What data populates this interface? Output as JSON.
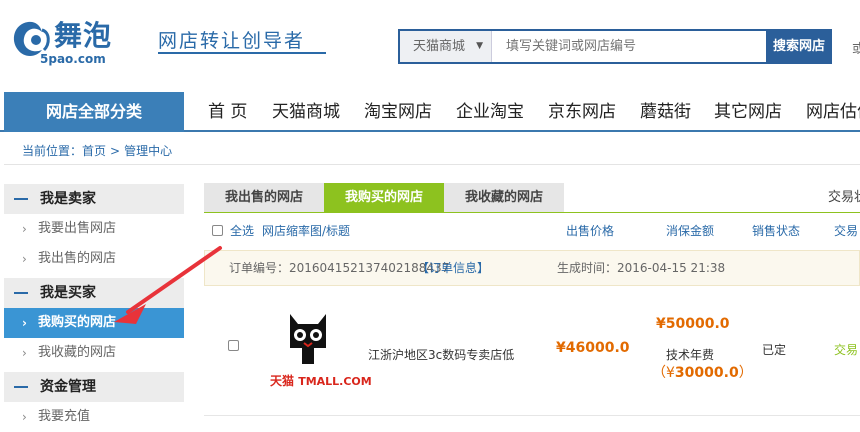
{
  "header": {
    "logo_text": "舞泡",
    "logo_url": "5pao.com",
    "slogan": "网店转让创导者",
    "search_category": "天猫商城",
    "search_placeholder": "填写关键词或网店编号",
    "search_button": "搜索网店",
    "extra": "或"
  },
  "nav": {
    "category_label": "网店全部分类",
    "items": [
      "首 页",
      "天猫商城",
      "淘宝网店",
      "企业淘宝",
      "京东网店",
      "蘑菇街",
      "其它网店",
      "网店估价"
    ]
  },
  "breadcrumb": {
    "prefix": "当前位置：",
    "items": [
      "首页",
      "管理中心"
    ],
    "separator": ">"
  },
  "sidebar": {
    "sections": [
      {
        "title": "我是卖家",
        "items": [
          {
            "label": "我要出售网店",
            "arrow": "›"
          },
          {
            "label": "我出售的网店",
            "arrow": "›"
          }
        ]
      },
      {
        "title": "我是买家",
        "items": [
          {
            "label": "我购买的网店",
            "arrow": "›"
          },
          {
            "label": "我收藏的网店",
            "arrow": "›"
          }
        ]
      },
      {
        "title": "资金管理",
        "items": [
          {
            "label": "我要充值",
            "arrow": "›"
          }
        ]
      }
    ]
  },
  "tabs": {
    "items": [
      "我出售的网店",
      "我购买的网店",
      "我收藏的网店"
    ],
    "active_index": 1,
    "extra": "交易状"
  },
  "table": {
    "select_all": "全选",
    "columns": [
      "网店缩率图/标题",
      "出售价格",
      "消保金额",
      "销售状态",
      "交易"
    ]
  },
  "order": {
    "number_label": "订单编号：",
    "number": "201604152137402188437",
    "info_link": "【订单信息】",
    "time_label": "生成时间：",
    "time": "2016-04-15 21:38"
  },
  "product": {
    "logo_cn": "天猫",
    "logo_en": "TMALL.COM",
    "title": "江浙沪地区3c数码专卖店低",
    "price": "¥46000.0",
    "deposit": "¥50000.0",
    "fee_label": "技术年费",
    "fee_prefix": "（¥",
    "fee": "30000.0",
    "fee_suffix": "）",
    "status": "已定",
    "trade": "交易"
  },
  "colors": {
    "brand_blue": "#2a6aa8",
    "nav_blue": "#3b7fb8",
    "active_green": "#8dc21f",
    "sidebar_active": "#3a95d4",
    "price_orange": "#e26a00",
    "annotation_red": "#e8333a"
  }
}
